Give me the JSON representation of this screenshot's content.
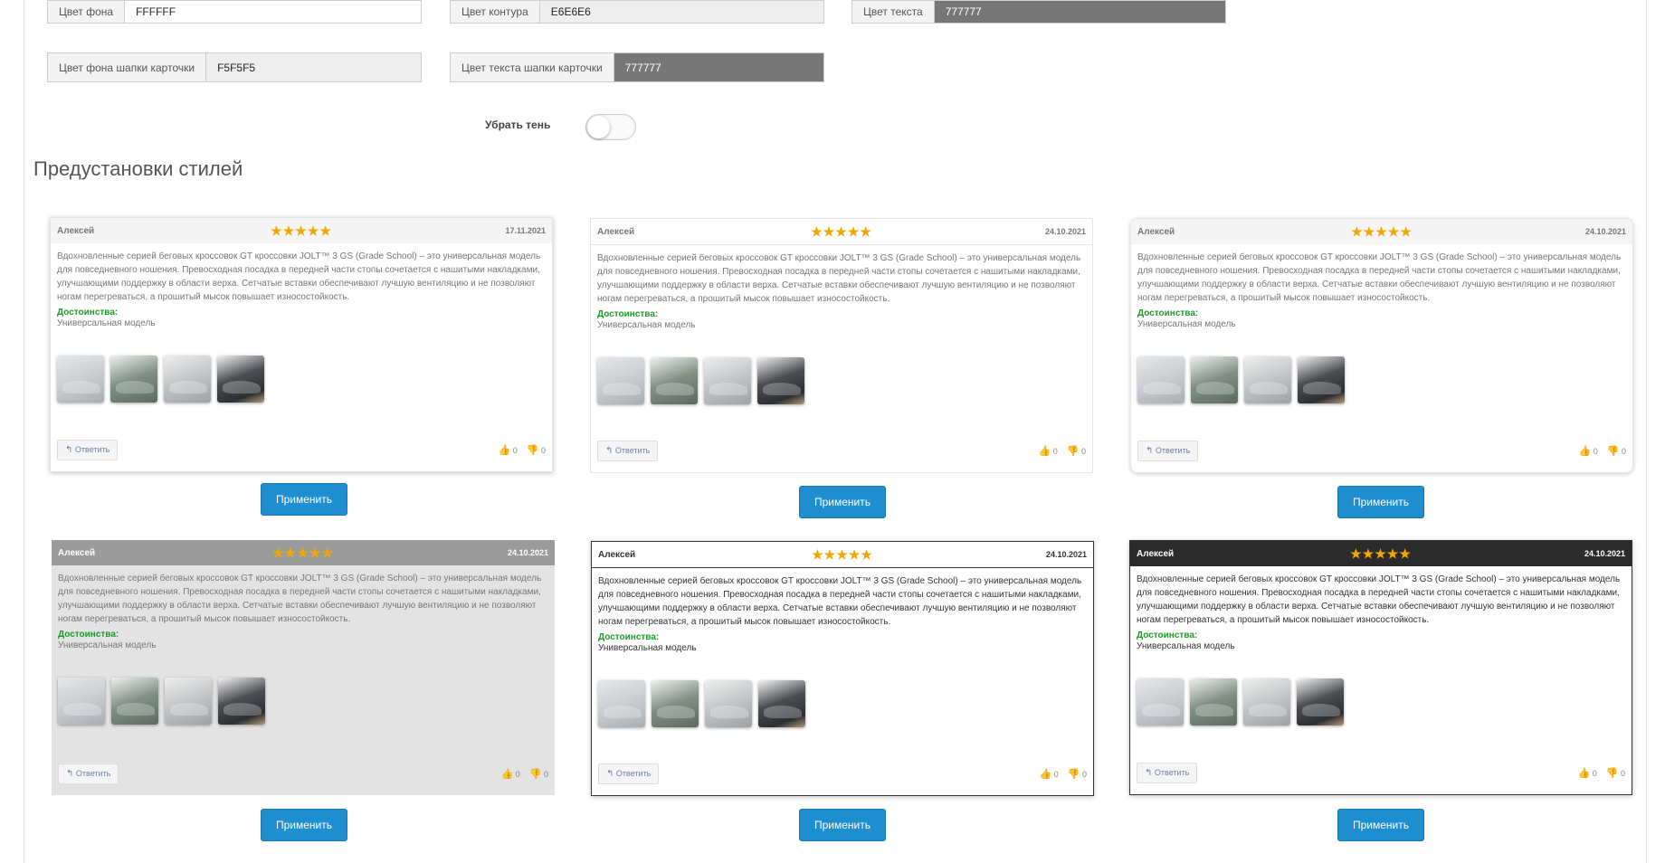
{
  "settings": {
    "bg_color": {
      "label": "Цвет фона",
      "value": "FFFFFF"
    },
    "border_color": {
      "label": "Цвет контура",
      "value": "E6E6E6"
    },
    "text_color": {
      "label": "Цвет текста",
      "value": "777777"
    },
    "header_bg_color": {
      "label": "Цвет фона шапки карточки",
      "value": "F5F5F5"
    },
    "header_text_color": {
      "label": "Цвет текста шапки карточки",
      "value": "777777"
    },
    "shadow_toggle": {
      "label": "Убрать тень",
      "on": false
    }
  },
  "presets_title": "Предустановки стилей",
  "review": {
    "author": "Алексей",
    "stars": "★★★★★",
    "text": "Вдохновленные серией беговых кроссовок GT кроссовки JOLT™ 3 GS (Grade School) – это универсальная модель для повседневного ношения. Превосходная посадка в передней части стопы сочетается с нашитыми накладками, улучшающими поддержку в области верха. Сетчатые вставки обеспечивают лучшую вентиляцию и не позволяют ногам перегреваться, а прошитый мысок повышает износостойкость.",
    "advantages_label": "Достоинства:",
    "advantages_text": "Универсальная модель",
    "reply_label": "Ответить",
    "likes": "0",
    "dislikes": "0",
    "photos": [
      "shoe-grey",
      "shoe-green",
      "shoe-light-grey",
      "shoe-black"
    ]
  },
  "presets": [
    {
      "date": "17.11.2021"
    },
    {
      "date": "24.10.2021"
    },
    {
      "date": "24.10.2021"
    },
    {
      "date": "24.10.2021"
    },
    {
      "date": "24.10.2021"
    },
    {
      "date": "24.10.2021"
    }
  ],
  "apply_label": "Применить",
  "colors": {
    "accent": "#1f8ecf",
    "advantages": "#1f9a2a",
    "stars": "#f0a800"
  }
}
